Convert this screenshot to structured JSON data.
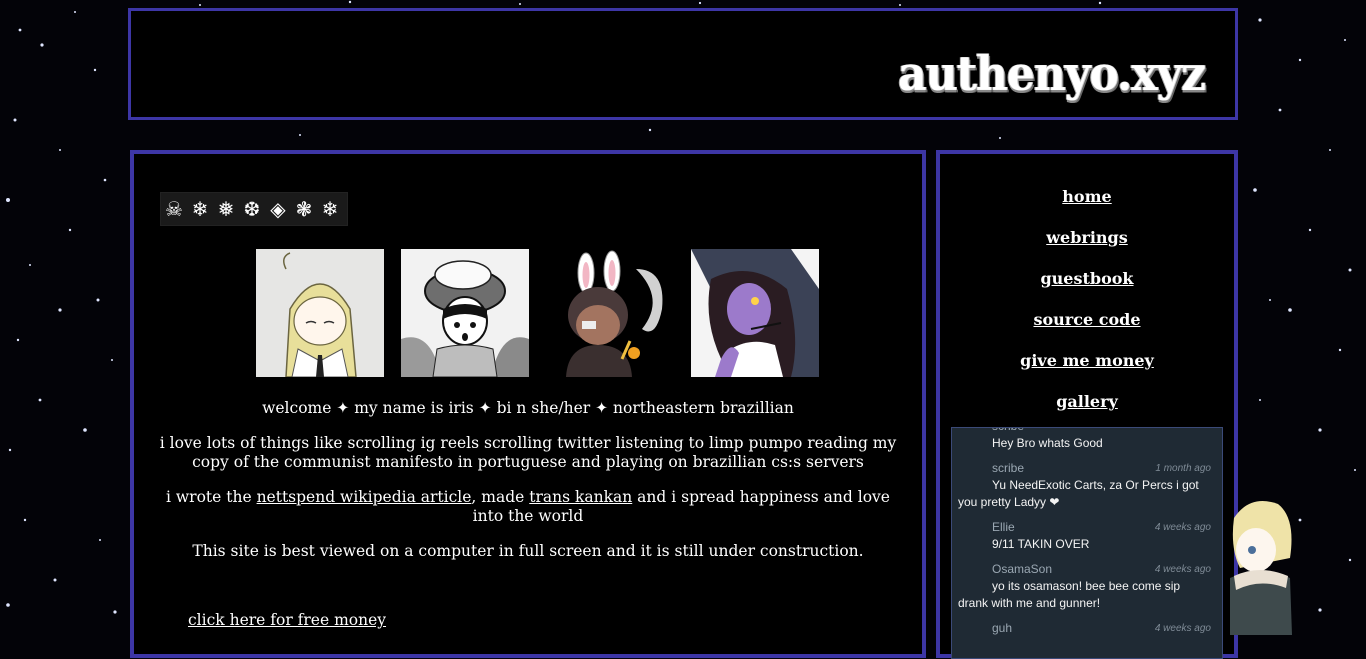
{
  "site": {
    "logo_text": "authenyo.xyz"
  },
  "colors": {
    "border": "#3d36a6",
    "background": "#000000",
    "guestbook_bg": "#1f2a34"
  },
  "banner": {
    "glyphs": [
      "skull-icon",
      "snowflake-icon",
      "snowflake-icon",
      "snowflake-icon",
      "diamond-icon",
      "snowflake-icon",
      "snowflake-icon"
    ]
  },
  "main": {
    "welcome": "welcome ✦ my name is iris ✦ bi n she/her ✦ northeastern brazillian",
    "likes": "i love lots of things like scrolling ig reels scrolling twitter listening to limp pumpo reading my copy of the communist manifesto in portuguese and playing on brazillian cs:s servers",
    "wrote_prefix": "i wrote the ",
    "wiki_link": "nettspend wikipedia article",
    "made_text": ", made ",
    "kankan_link": "trans kankan",
    "wrote_suffix": " and i spread happiness and love into the world",
    "notice": "This site is best viewed on a computer in full screen and it is still under construction.",
    "free_money_link": "click here for free money"
  },
  "nav": {
    "home": "home",
    "webrings": "webrings",
    "guestbook": "guestbook",
    "source_code": "source code",
    "give_money": "give me money",
    "gallery": "gallery"
  },
  "guestbook_entries": [
    {
      "name": "scribe",
      "time": "",
      "message": "Hey Bro whats Good"
    },
    {
      "name": "scribe",
      "time": "1 month ago",
      "message": "Yu NeedExotic Carts, za Or Percs i got you pretty Ladyy ❤"
    },
    {
      "name": "Ellie",
      "time": "4 weeks ago",
      "message": "9/11 TAKIN OVER"
    },
    {
      "name": "OsamaSon",
      "time": "4 weeks ago",
      "message": "yo its osamason! bee bee come sip drank with me and gunner!"
    },
    {
      "name": "guh",
      "time": "4 weeks ago",
      "message": ""
    }
  ]
}
